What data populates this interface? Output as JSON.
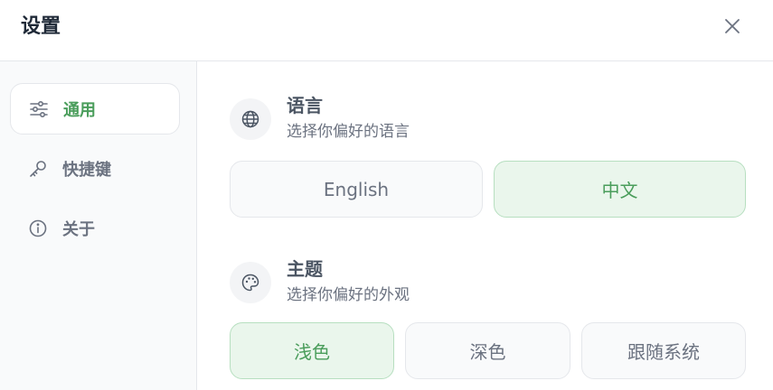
{
  "dialog": {
    "title": "设置"
  },
  "sidebar": {
    "items": [
      {
        "label": "通用",
        "icon": "sliders-icon",
        "active": true
      },
      {
        "label": "快捷键",
        "icon": "key-icon",
        "active": false
      },
      {
        "label": "关于",
        "icon": "info-icon",
        "active": false
      }
    ]
  },
  "language": {
    "title": "语言",
    "description": "选择你偏好的语言",
    "icon": "globe-icon",
    "options": [
      {
        "label": "English",
        "selected": false
      },
      {
        "label": "中文",
        "selected": true
      }
    ]
  },
  "theme": {
    "title": "主题",
    "description": "选择你偏好的外观",
    "icon": "palette-icon",
    "options": [
      {
        "label": "浅色",
        "selected": true
      },
      {
        "label": "深色",
        "selected": false
      },
      {
        "label": "跟随系统",
        "selected": false
      }
    ]
  },
  "colors": {
    "accent": "#4a9d5b",
    "selected_bg": "#eaf6ec",
    "text_muted": "#6b7280"
  }
}
